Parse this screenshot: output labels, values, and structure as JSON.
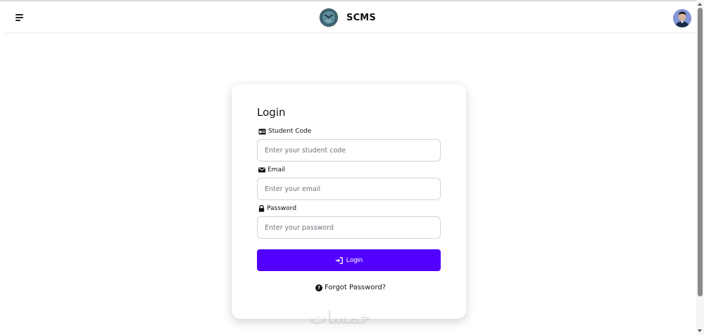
{
  "app": {
    "title": "SCMS"
  },
  "navbar": {
    "menu_icon": "hamburger-menu-icon",
    "logo_icon": "scms-logo",
    "avatar_icon": "user-avatar"
  },
  "login": {
    "title": "Login",
    "fields": [
      {
        "label": "Student Code",
        "icon": "id-card-icon",
        "placeholder": "Enter your student code",
        "value": ""
      },
      {
        "label": "Email",
        "icon": "envelope-icon",
        "placeholder": "Enter your email",
        "value": ""
      },
      {
        "label": "Password",
        "icon": "lock-icon",
        "placeholder": "Enter your password",
        "value": ""
      }
    ],
    "submit_label": "Login",
    "submit_icon": "sign-in-icon",
    "forgot_label": "Forgot Password?",
    "forgot_icon": "question-circle-icon"
  },
  "watermark": {
    "text": "خمسات"
  },
  "colors": {
    "primary": "#5200ff",
    "border": "#cfd4da",
    "text": "#111111"
  }
}
